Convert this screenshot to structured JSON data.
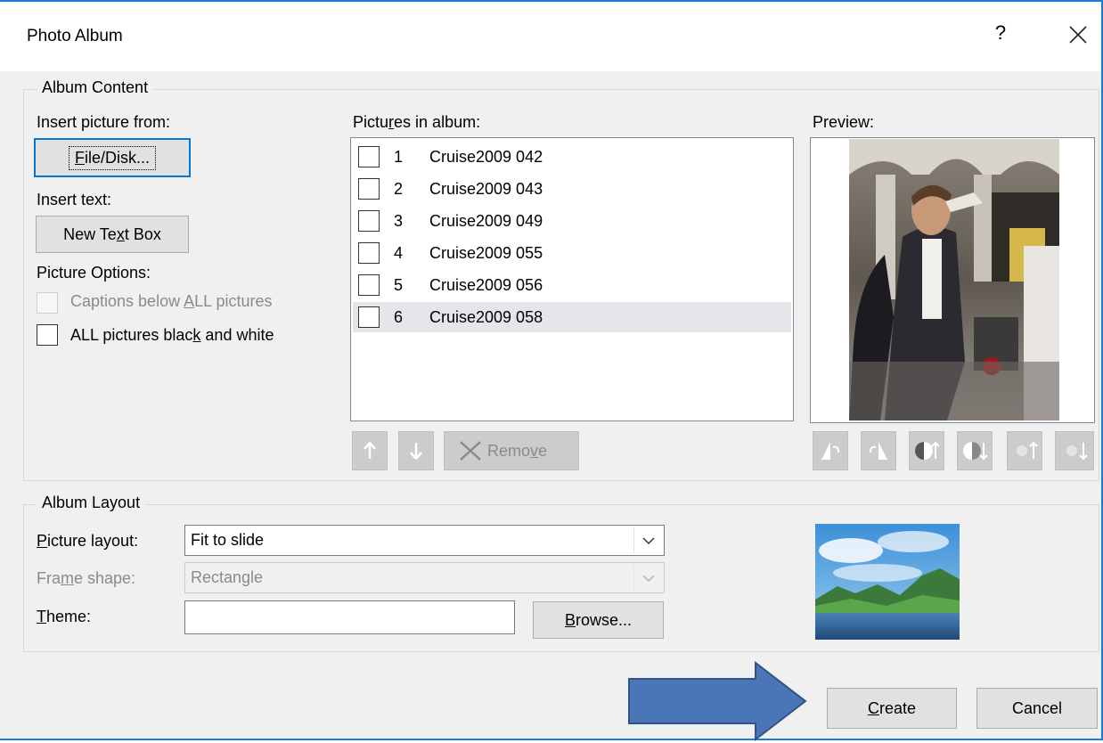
{
  "dialog": {
    "title": "Photo Album",
    "help_label": "?"
  },
  "album_content": {
    "legend": "Album Content",
    "insert_picture_from": "Insert picture from:",
    "file_disk_button": {
      "pre": "",
      "u": "F",
      "post": "ile/Disk..."
    },
    "insert_text": "Insert text:",
    "new_text_box_button": {
      "pre": "New Te",
      "u": "x",
      "post": "t Box"
    },
    "picture_options": "Picture Options:",
    "captions_option": {
      "pre": "Captions below ",
      "u": "A",
      "post": "LL pictures",
      "checked": false,
      "enabled": false
    },
    "black_white_option": {
      "pre": "ALL pictures blac",
      "u": "k",
      "post": " and white",
      "checked": false,
      "enabled": true
    },
    "pictures_label": {
      "pre": "Pictu",
      "u": "r",
      "post": "es in album:"
    },
    "pictures": [
      {
        "num": "1",
        "name": "Cruise2009 042",
        "selected": false
      },
      {
        "num": "2",
        "name": "Cruise2009 043",
        "selected": false
      },
      {
        "num": "3",
        "name": "Cruise2009 049",
        "selected": false
      },
      {
        "num": "4",
        "name": "Cruise2009 055",
        "selected": false
      },
      {
        "num": "5",
        "name": "Cruise2009 056",
        "selected": false
      },
      {
        "num": "6",
        "name": "Cruise2009 058",
        "selected": true
      }
    ],
    "remove_button": {
      "pre": "Remo",
      "u": "v",
      "post": "e"
    },
    "preview_label": "Preview:"
  },
  "album_layout": {
    "legend": "Album Layout",
    "picture_layout_label": {
      "pre": "",
      "u": "P",
      "post": "icture layout:"
    },
    "picture_layout_value": "Fit to slide",
    "frame_shape_label": {
      "pre": "Fra",
      "u": "m",
      "post": "e shape:"
    },
    "frame_shape_value": "Rectangle",
    "theme_label": {
      "pre": "",
      "u": "T",
      "post": "heme:"
    },
    "theme_value": "",
    "browse_button": {
      "pre": "",
      "u": "B",
      "post": "rowse..."
    }
  },
  "footer": {
    "create_button": {
      "pre": "",
      "u": "C",
      "post": "reate"
    },
    "cancel_button": "Cancel"
  },
  "colors": {
    "accent": "#0078d7",
    "window_border": "#1c7cd5",
    "arrow_fill": "#4a76b8",
    "arrow_stroke": "#2f5486"
  }
}
